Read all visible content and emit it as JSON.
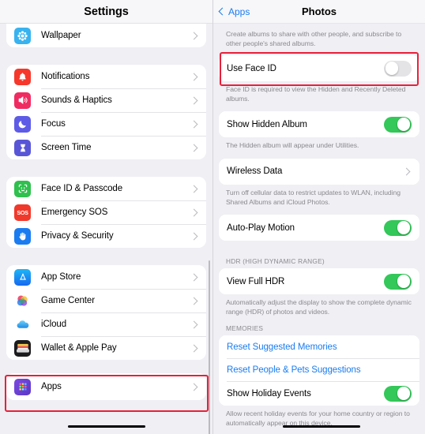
{
  "left_pane": {
    "title": "Settings",
    "groups": [
      {
        "id": "g0",
        "items": [
          {
            "label": "Wallpaper",
            "icon": "wallpaper-icon",
            "color": "#38b3ef"
          }
        ]
      },
      {
        "id": "g1",
        "items": [
          {
            "label": "Notifications",
            "icon": "bell-icon",
            "color": "#f5382b"
          },
          {
            "label": "Sounds & Haptics",
            "icon": "speaker-icon",
            "color": "#f02b62"
          },
          {
            "label": "Focus",
            "icon": "moon-icon",
            "color": "#5e5ce6"
          },
          {
            "label": "Screen Time",
            "icon": "hourglass-icon",
            "color": "#5856d6"
          }
        ]
      },
      {
        "id": "g2",
        "items": [
          {
            "label": "Face ID & Passcode",
            "icon": "faceid-icon",
            "color": "#2fc04e"
          },
          {
            "label": "Emergency SOS",
            "icon": "sos-icon",
            "color": "#f0392b"
          },
          {
            "label": "Privacy & Security",
            "icon": "hand-icon",
            "color": "#1a7cf0"
          }
        ]
      },
      {
        "id": "g3",
        "items": [
          {
            "label": "App Store",
            "icon": "appstore-icon",
            "color": "#1e8cf5"
          },
          {
            "label": "Game Center",
            "icon": "gamecenter-icon",
            "color": "#ffffff"
          },
          {
            "label": "iCloud",
            "icon": "icloud-icon",
            "color": "#ffffff"
          },
          {
            "label": "Wallet & Apple Pay",
            "icon": "wallet-icon",
            "color": "#1c1c1e"
          }
        ]
      },
      {
        "id": "g4",
        "items": [
          {
            "label": "Apps",
            "icon": "apps-grid-icon",
            "color": "#6b4bd6"
          }
        ]
      }
    ]
  },
  "right_pane": {
    "back_label": "Apps",
    "title": "Photos",
    "shared_albums_footer": "Create albums to share with other people, and subscribe to other people's shared albums.",
    "face_id": {
      "label": "Use Face ID",
      "state": "off"
    },
    "face_id_footer": "Face ID is required to view the Hidden and Recently Deleted albums.",
    "hidden_album": {
      "label": "Show Hidden Album",
      "state": "on"
    },
    "hidden_album_footer": "The Hidden album will appear under Utilities.",
    "wireless_data": {
      "label": "Wireless Data"
    },
    "wireless_data_footer": "Turn off cellular data to restrict updates to WLAN, including Shared Albums and iCloud Photos.",
    "autoplay": {
      "label": "Auto-Play Motion",
      "state": "on"
    },
    "hdr_header": "HDR (HIGH DYNAMIC RANGE)",
    "view_full_hdr": {
      "label": "View Full HDR",
      "state": "on"
    },
    "hdr_footer": "Automatically adjust the display to show the complete dynamic range (HDR) of photos and videos.",
    "memories_header": "MEMORIES",
    "memories": [
      {
        "label": "Reset Suggested Memories",
        "type": "link"
      },
      {
        "label": "Reset People & Pets Suggestions",
        "type": "link"
      },
      {
        "label": "Show Holiday Events",
        "type": "toggle",
        "state": "on"
      }
    ],
    "memories_footer": "Allow recent holiday events for your home country or region to automatically appear on this device."
  },
  "annotations": {
    "highlight_color": "#e8203a",
    "boxes": [
      {
        "name": "apps-row-highlight"
      },
      {
        "name": "use-face-id-highlight"
      }
    ]
  },
  "theme": {
    "toggle_on": "#34C759",
    "toggle_off": "#E4E4E7",
    "link_blue": "#1A7CF0",
    "background": "#EFEFF4"
  }
}
